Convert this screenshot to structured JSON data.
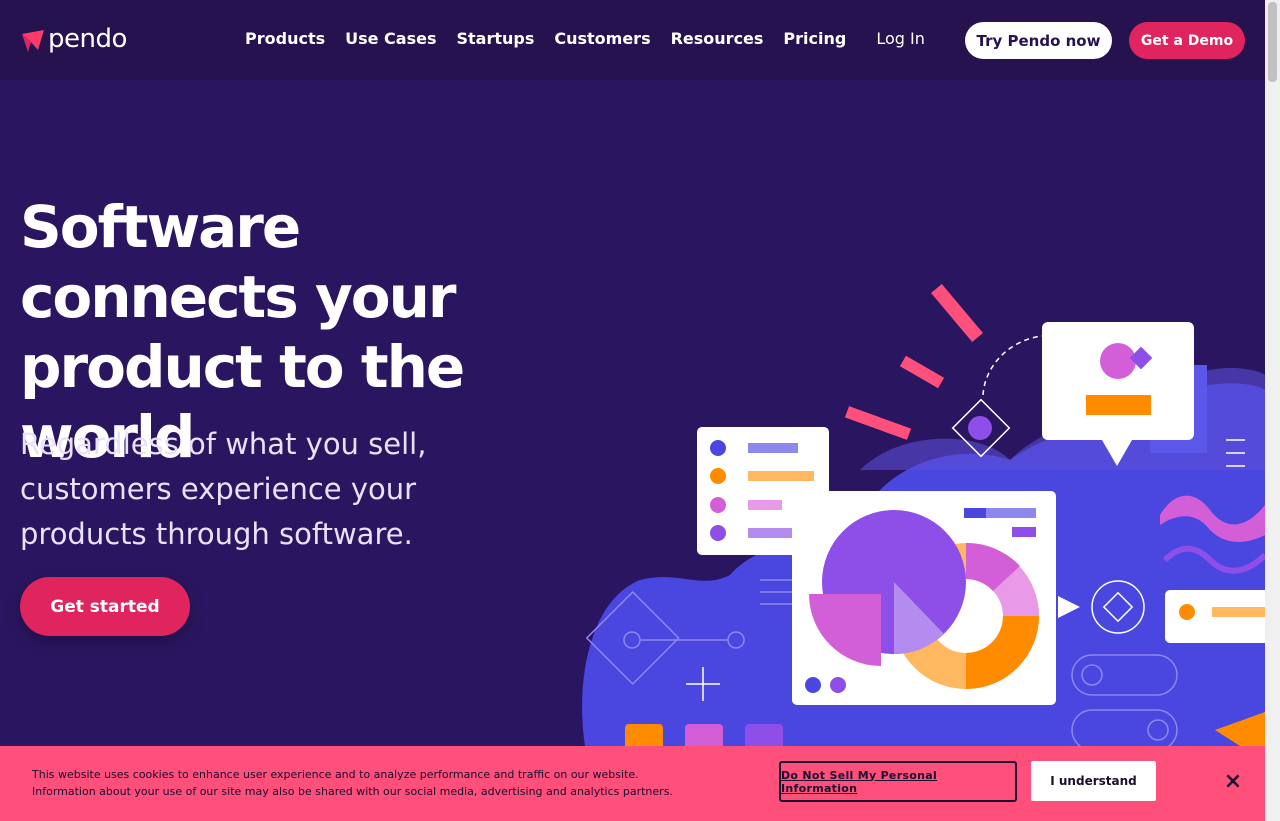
{
  "header": {
    "logo_text": "pendo",
    "nav": [
      "Products",
      "Use Cases",
      "Startups",
      "Customers",
      "Resources",
      "Pricing"
    ],
    "login": "Log In",
    "try_button": "Try Pendo now",
    "demo_button": "Get a Demo"
  },
  "hero": {
    "title": "Software connects your product to the world",
    "subtitle": "Regardless of what you sell, customers experience your products through software.",
    "cta": "Get started"
  },
  "cookie": {
    "text_line1": "This website uses cookies to enhance user experience and to analyze performance and traffic on our website.",
    "text_line2": "Information about your use of our site may also be shared with our social media, advertising and analytics partners.",
    "dns_button": "Do Not Sell My Personal Information",
    "accept_button": "I understand",
    "close": "×"
  },
  "colors": {
    "background": "#2a1660",
    "header": "#25124f",
    "accent": "#e0245e",
    "cookie_bg": "#ff4f7b",
    "orange": "#ff8c00",
    "purple": "#8e4ee8",
    "magenta": "#d35fd8",
    "blue": "#4a46e0"
  }
}
